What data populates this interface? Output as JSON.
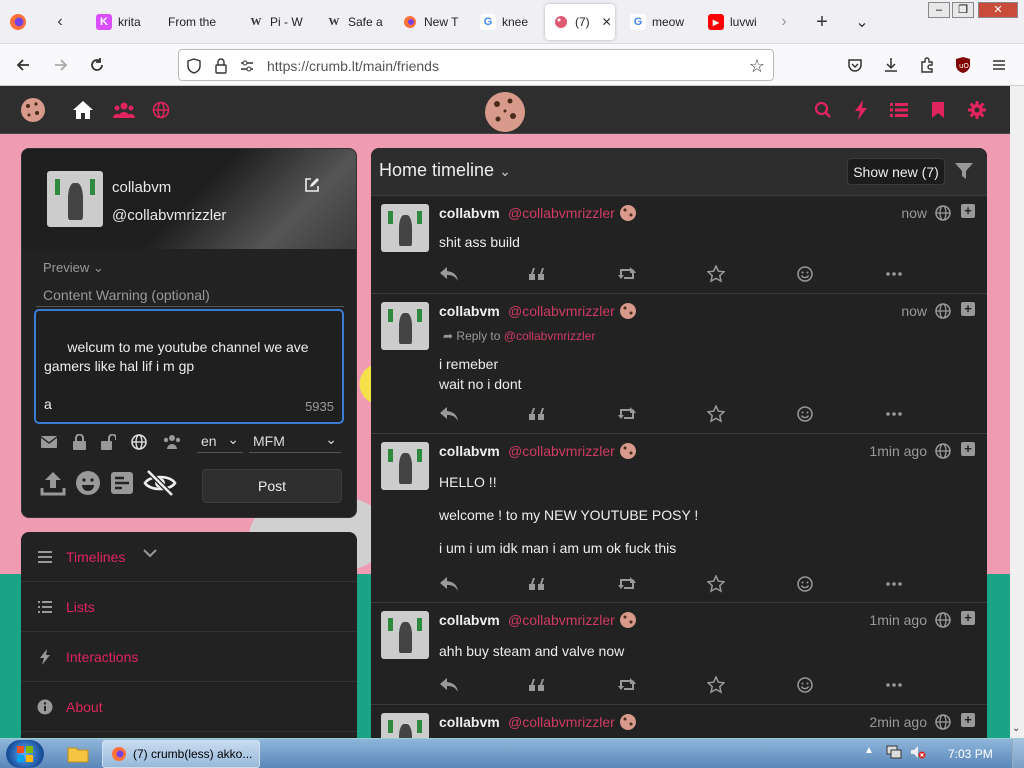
{
  "browser": {
    "tabs": [
      {
        "label": "",
        "icon": "firefox-icon",
        "color": "#ff7139"
      },
      {
        "label": "krita",
        "icon": "krita-icon",
        "color": "#d94eff"
      },
      {
        "label": "From the",
        "icon": "",
        "color": ""
      },
      {
        "label": "Pi - W",
        "icon": "W",
        "color": "#333333"
      },
      {
        "label": "Safe a",
        "icon": "W",
        "color": "#333333"
      },
      {
        "label": "New T",
        "icon": "firefox-icon",
        "color": "#ff7139"
      },
      {
        "label": "knee",
        "icon": "G",
        "color": "#4285f4"
      },
      {
        "label": "(7)",
        "icon": "cookie-icon",
        "color": "#e05a73"
      },
      {
        "label": "meow",
        "icon": "G",
        "color": "#4285f4"
      },
      {
        "label": "luvwi",
        "icon": "youtube-icon",
        "color": "#ff0000"
      }
    ],
    "url": "https://crumb.lt/main/friends"
  },
  "compose": {
    "display_name": "collabvm",
    "handle": "@collabvmrizzler",
    "preview_label": "Preview",
    "cw_placeholder": "Content Warning (optional)",
    "text": "welcum to me youtube channel we ave gamers like hal lif i m gp\n\na",
    "char_counter": "5935",
    "language": "en",
    "format": "MFM",
    "post_label": "Post"
  },
  "sidenav": {
    "items": [
      {
        "label": "Timelines",
        "icon": "menu-icon",
        "active": true
      },
      {
        "label": "Lists",
        "icon": "list-icon",
        "active": false
      },
      {
        "label": "Interactions",
        "icon": "bolt-icon",
        "active": false
      },
      {
        "label": "About",
        "icon": "info-icon",
        "active": false
      }
    ]
  },
  "timeline": {
    "title": "Home timeline",
    "show_new": "Show new (7)",
    "posts": [
      {
        "name": "collabvm",
        "handle": "@collabvmrizzler",
        "time": "now",
        "reply_label": "",
        "reply_to": "",
        "body": [
          "shit ass build"
        ]
      },
      {
        "name": "collabvm",
        "handle": "@collabvmrizzler",
        "time": "now",
        "reply_label": "Reply to",
        "reply_to": "@collabvmrizzler",
        "body": [
          "i remeber",
          "wait no i dont"
        ]
      },
      {
        "name": "collabvm",
        "handle": "@collabvmrizzler",
        "time": "1min ago",
        "reply_label": "",
        "reply_to": "",
        "body": [
          "HELLO !!",
          "welcome ! to my NEW YOUTUBE POSY !",
          "i um i um idk man i am um ok fuck this"
        ]
      },
      {
        "name": "collabvm",
        "handle": "@collabvmrizzler",
        "time": "1min ago",
        "reply_label": "",
        "reply_to": "",
        "body": [
          "ahh buy steam and valve now"
        ]
      },
      {
        "name": "collabvm",
        "handle": "@collabvmrizzler",
        "time": "2min ago",
        "reply_label": "",
        "reply_to": "",
        "body": []
      }
    ]
  },
  "taskbar": {
    "window_label": "(7) crumb(less) akko...",
    "clock": "7:03 PM"
  },
  "colors": {
    "accent": "#e0245e",
    "panel": "#222222",
    "text": "#eeeeee"
  }
}
